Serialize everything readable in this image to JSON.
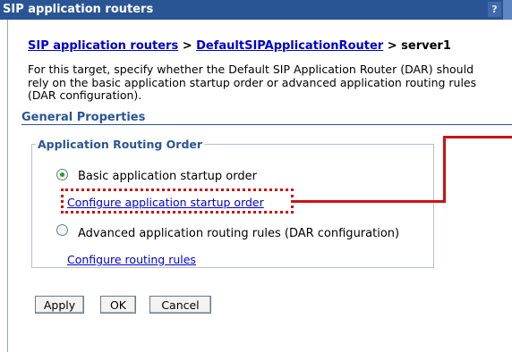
{
  "window": {
    "title": "SIP application routers",
    "help_glyph": "?"
  },
  "breadcrumb": {
    "link1": "SIP application routers",
    "sep1": " > ",
    "link2": "DefaultSIPApplicationRouter",
    "sep2": " > ",
    "current": "server1"
  },
  "description": "For this target, specify whether the Default SIP Application Router (DAR) should rely on the basic application startup order or advanced application routing rules (DAR configuration).",
  "general_properties": {
    "title": "General Properties"
  },
  "routing_order": {
    "legend": "Application Routing Order",
    "options": [
      {
        "label": "Basic application startup order",
        "checked": true,
        "link": "Configure application startup order"
      },
      {
        "label": "Advanced application routing rules (DAR configuration)",
        "checked": false,
        "link": "Configure routing rules"
      }
    ]
  },
  "buttons": {
    "apply": "Apply",
    "ok": "OK",
    "cancel": "Cancel"
  },
  "colors": {
    "title_bar": "#2a5595",
    "link": "#0000cc",
    "highlight": "#cc1111",
    "radio_selected": "#21a121"
  }
}
